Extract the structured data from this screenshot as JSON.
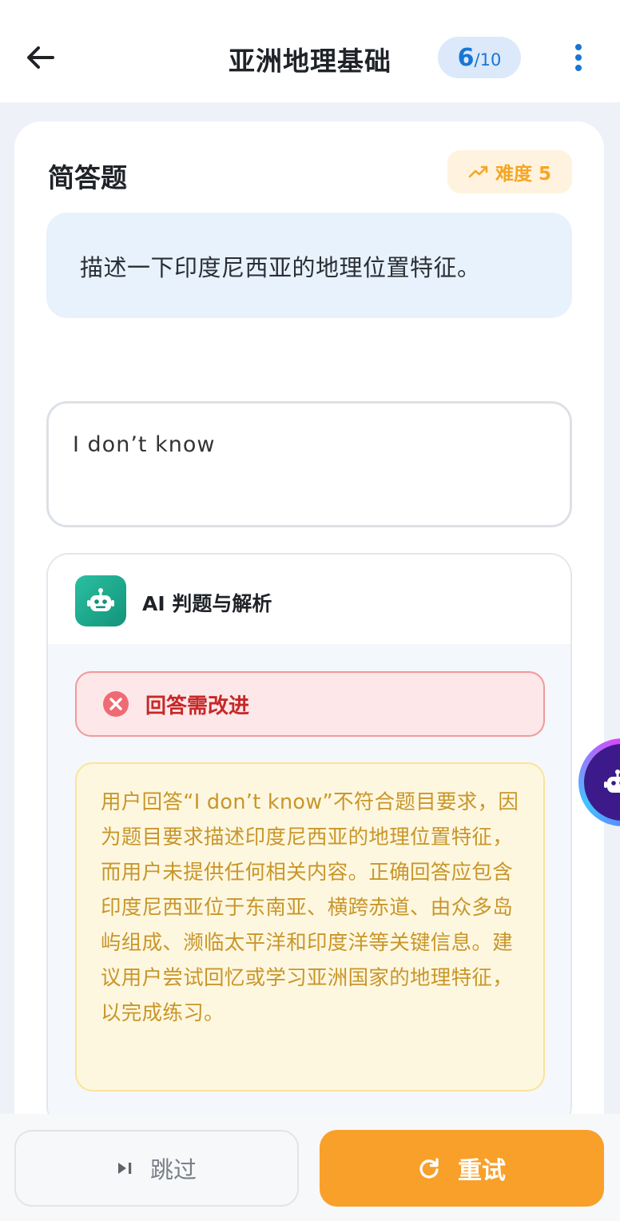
{
  "header": {
    "title": "亚洲地理基础",
    "progress_current": "6",
    "progress_total": "/10"
  },
  "question": {
    "type_label": "简答题",
    "difficulty_label": "难度 5",
    "text": "描述一下印度尼西亚的地理位置特征。"
  },
  "answer": {
    "value": "I don’t know"
  },
  "ai": {
    "title": "AI 判题与解析",
    "verdict": "回答需改进",
    "analysis": "用户回答“I don’t know”不符合题目要求，因为题目要求描述印度尼西亚的地理位置特征，而用户未提供任何相关内容。正确回答应包含印度尼西亚位于东南亚、横跨赤道、由众多岛屿组成、濒临太平洋和印度洋等关键信息。建议用户尝试回忆或学习亚洲国家的地理特征，以完成练习。"
  },
  "footer": {
    "skip_label": "跳过",
    "retry_label": "重试"
  },
  "colors": {
    "accent_blue": "#1976d2",
    "primary_orange": "#f8a02a",
    "error_red": "#c62828",
    "ai_teal": "#12947b"
  },
  "icons": {
    "back": "arrow-left-icon",
    "more": "more-vertical-icon",
    "difficulty": "trending-up-icon",
    "ai": "robot-icon",
    "verdict": "close-circle-icon",
    "skip": "skip-next-icon",
    "retry": "refresh-icon"
  }
}
